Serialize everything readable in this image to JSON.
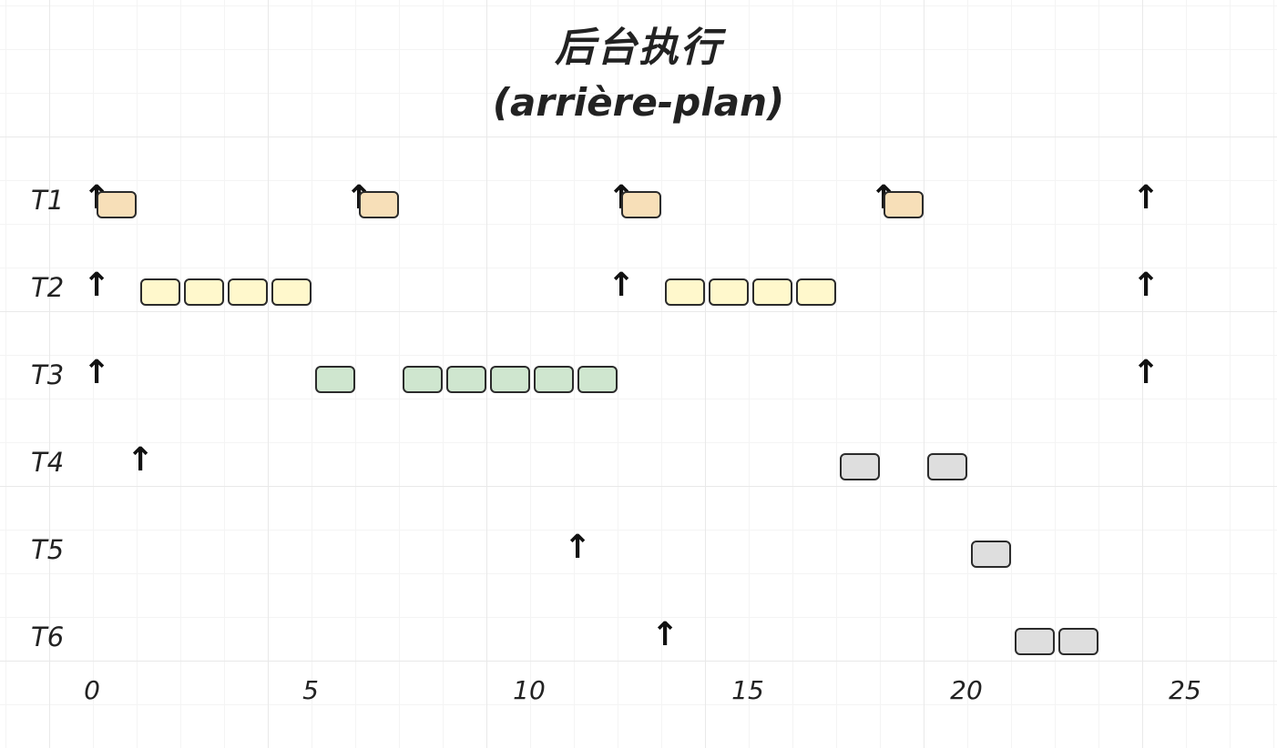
{
  "title": "后台执行",
  "subtitle": "(arrière-plan)",
  "chart_data": {
    "type": "gantt",
    "x_ticks": [
      0,
      5,
      10,
      15,
      20,
      25
    ],
    "rows": [
      {
        "label": "T1",
        "color": "#f7dfb8",
        "arrivals": [
          0,
          6,
          12,
          18,
          24
        ],
        "slots": [
          0,
          6,
          12,
          18
        ]
      },
      {
        "label": "T2",
        "color": "#fff8cc",
        "arrivals": [
          0,
          12,
          24
        ],
        "slots": [
          1,
          2,
          3,
          4,
          13,
          14,
          15,
          16
        ]
      },
      {
        "label": "T3",
        "color": "#cfe6cf",
        "arrivals": [
          0,
          24
        ],
        "slots": [
          5,
          7,
          8,
          9,
          10,
          11
        ]
      },
      {
        "label": "T4",
        "color": "#dedede",
        "arrivals": [
          1
        ],
        "slots": [
          17,
          19
        ]
      },
      {
        "label": "T5",
        "color": "#dedede",
        "arrivals": [
          11
        ],
        "slots": [
          20
        ]
      },
      {
        "label": "T6",
        "color": "#dedede",
        "arrivals": [
          13
        ],
        "slots": [
          21,
          22
        ]
      }
    ]
  }
}
